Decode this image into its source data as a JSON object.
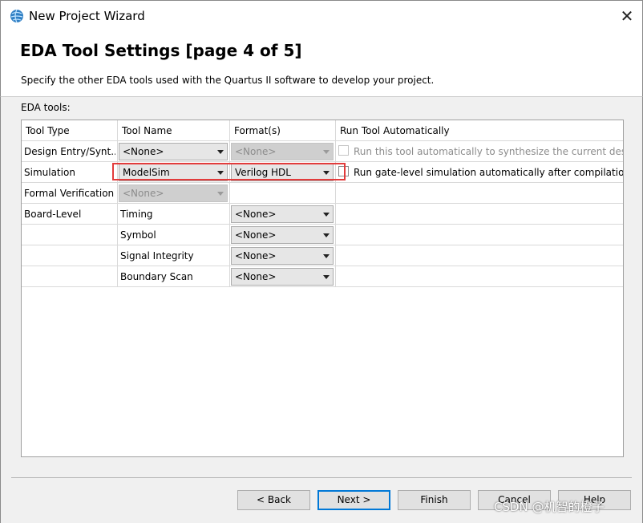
{
  "window": {
    "title": "New Project Wizard",
    "close_glyph": "✕"
  },
  "header": {
    "title": "EDA Tool Settings [page 4 of 5]",
    "description": "Specify the other EDA tools used with the Quartus II software to develop your project."
  },
  "section_label": "EDA tools:",
  "table": {
    "columns": [
      "Tool Type",
      "Tool Name",
      "Format(s)",
      "Run Tool Automatically"
    ],
    "rows": [
      {
        "type": "Design Entry/Synt...",
        "tool_name": "<None>",
        "format": "<None>",
        "run_label": "Run this tool automatically to synthesize the current design"
      },
      {
        "type": "Simulation",
        "tool_name": "ModelSim",
        "format": "Verilog HDL",
        "run_label": "Run gate-level simulation automatically after compilation"
      },
      {
        "type": "Formal Verification",
        "tool_name": "<None>"
      },
      {
        "type": "Board-Level",
        "tool_name": "Timing",
        "format": "<None>"
      },
      {
        "type": "",
        "tool_name": "Symbol",
        "format": "<None>"
      },
      {
        "type": "",
        "tool_name": "Signal Integrity",
        "format": "<None>"
      },
      {
        "type": "",
        "tool_name": "Boundary Scan",
        "format": "<None>"
      }
    ]
  },
  "buttons": {
    "back": "< Back",
    "next": "Next >",
    "finish": "Finish",
    "cancel": "Cancel",
    "help": "Help"
  },
  "watermark": "CSDN @机智的橙子",
  "colors": {
    "highlight": "#e23c3c",
    "default_button": "#0078d7"
  }
}
